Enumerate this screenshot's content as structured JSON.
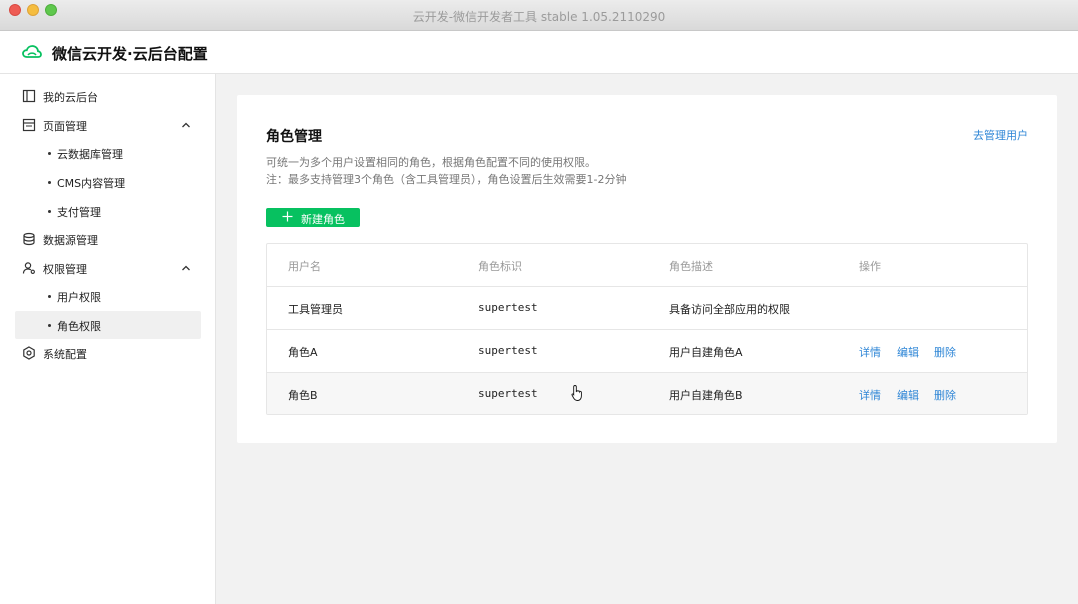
{
  "window": {
    "title": "云开发-微信开发者工具 stable 1.05.2110290"
  },
  "header": {
    "title": "微信云开发·云后台配置"
  },
  "sidebar": {
    "items": [
      {
        "label": "我的云后台"
      },
      {
        "label": "页面管理"
      },
      {
        "label": "云数据库管理"
      },
      {
        "label": "CMS内容管理"
      },
      {
        "label": "支付管理"
      },
      {
        "label": "数据源管理"
      },
      {
        "label": "权限管理"
      },
      {
        "label": "用户权限"
      },
      {
        "label": "角色权限"
      },
      {
        "label": "系统配置"
      }
    ]
  },
  "main": {
    "title": "角色管理",
    "manage_users_link": "去管理用户",
    "desc_line1": "可统一为多个用户设置相同的角色，根据角色配置不同的使用权限。",
    "desc_line2": "注：最多支持管理3个角色（含工具管理员），角色设置后生效需要1-2分钟",
    "new_role_button": "新建角色",
    "table": {
      "headers": [
        "用户名",
        "角色标识",
        "角色描述",
        "操作"
      ],
      "rows": [
        {
          "name": "工具管理员",
          "id": "supertest",
          "desc": "具备访问全部应用的权限",
          "ops": []
        },
        {
          "name": "角色A",
          "id": "supertest",
          "desc": "用户自建角色A",
          "ops": [
            "详情",
            "编辑",
            "删除"
          ]
        },
        {
          "name": "角色B",
          "id": "supertest",
          "desc": "用户自建角色B",
          "ops": [
            "详情",
            "编辑",
            "删除"
          ]
        }
      ]
    }
  },
  "colors": {
    "accent_green": "#07c160",
    "link_blue": "#2e86d6"
  }
}
